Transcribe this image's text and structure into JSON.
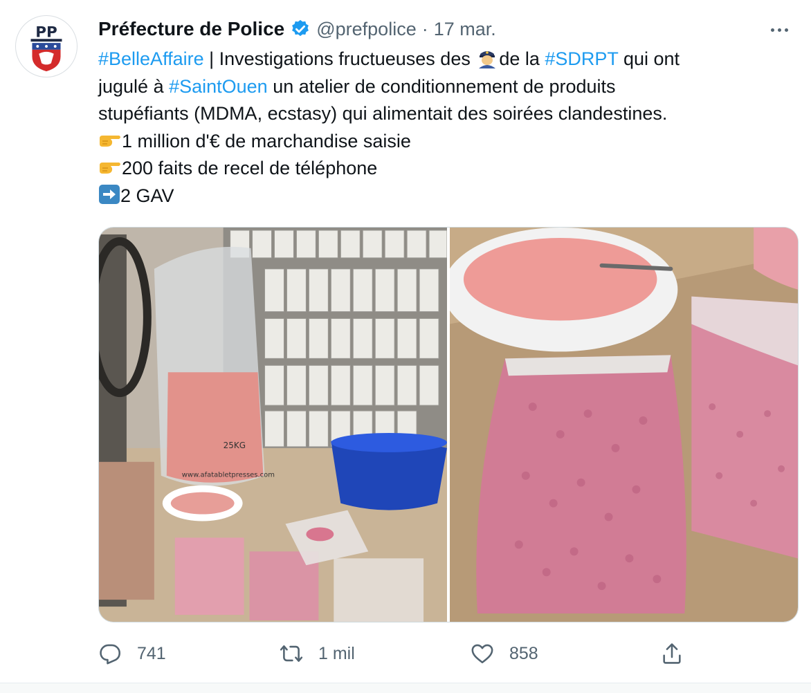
{
  "tweet": {
    "author": {
      "name": "Préfecture de Police",
      "handle": "@prefpolice",
      "verified": true,
      "avatar_icon": "prefecture-police-logo",
      "avatar_letters": "PP"
    },
    "separator": "·",
    "date": "17 mar.",
    "text": {
      "line1": {
        "hashtag1": "#BelleAffaire",
        "part1": " | Investigations fructueuses des ",
        "emoji": "👮",
        "part2": "de la ",
        "hashtag2": "#SDRPT",
        "part3": " qui ont"
      },
      "line2": {
        "part1": "jugulé à ",
        "hashtag": "#SaintOuen",
        "part2": " un atelier de conditionnement de produits"
      },
      "line3": "stupéfiants (MDMA, ecstasy) qui alimentait des soirées clandestines.",
      "line4": "1 million d'€ de marchandise saisie",
      "line5": "200 faits de recel de téléphone",
      "line6": "2 GAV",
      "bullet_icon": "backhand-pointing-right-emoji",
      "arrow_icon": "right-arrow-emoji"
    },
    "media": [
      {
        "description_icon": "seized-drugs-photo-office",
        "labels": [
          "25KG",
          "www.afatabletpresses.com"
        ]
      },
      {
        "description_icon": "seized-pills-bags-photo"
      }
    ],
    "actions": {
      "reply_count": "741",
      "retweet_count": "1 mil",
      "like_count": "858"
    },
    "colors": {
      "link": "#1d9bf0",
      "secondary_text": "#536471",
      "verified": "#1d9bf0"
    }
  }
}
